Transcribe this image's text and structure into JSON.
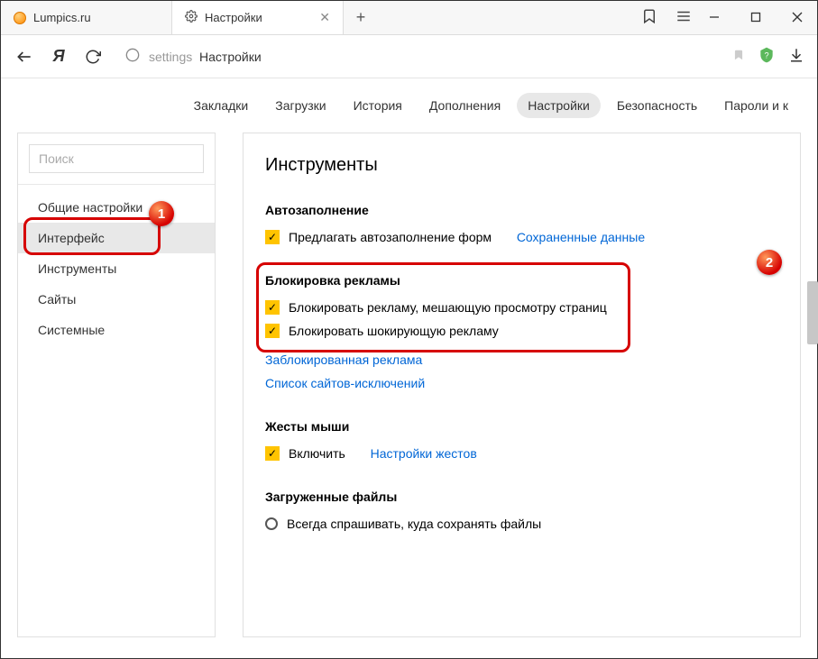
{
  "tabs": [
    {
      "title": "Lumpics.ru",
      "active": false
    },
    {
      "title": "Настройки",
      "active": true
    }
  ],
  "url": {
    "prefix": "settings",
    "suffix": "Настройки"
  },
  "topNav": [
    "Закладки",
    "Загрузки",
    "История",
    "Дополнения",
    "Настройки",
    "Безопасность",
    "Пароли и к"
  ],
  "topNavActive": "Настройки",
  "sidebar": {
    "searchPlaceholder": "Поиск",
    "items": [
      "Общие настройки",
      "Интерфейс",
      "Инструменты",
      "Сайты",
      "Системные"
    ],
    "active": "Интерфейс"
  },
  "badges": {
    "b1": "1",
    "b2": "2"
  },
  "main": {
    "heading": "Инструменты",
    "autofill": {
      "title": "Автозаполнение",
      "check": "Предлагать автозаполнение форм",
      "link": "Сохраненные данные"
    },
    "adblock": {
      "title": "Блокировка рекламы",
      "check1": "Блокировать рекламу, мешающую просмотру страниц",
      "check2": "Блокировать шокирующую рекламу",
      "link1": "Заблокированная реклама",
      "link2": "Список сайтов-исключений"
    },
    "mouse": {
      "title": "Жесты мыши",
      "check": "Включить",
      "link": "Настройки жестов"
    },
    "downloads": {
      "title": "Загруженные файлы",
      "radio": "Всегда спрашивать, куда сохранять файлы"
    }
  }
}
